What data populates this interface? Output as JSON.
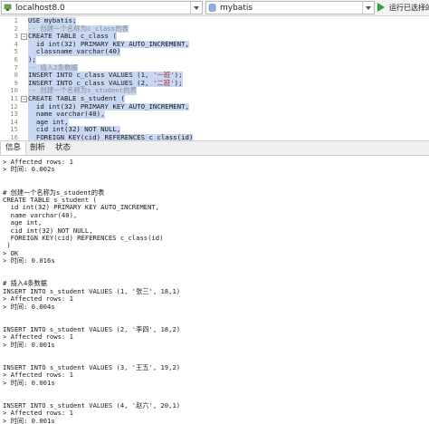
{
  "toolbar": {
    "connection": "localhost8.0",
    "database": "mybatis",
    "run_label": "运行已选择的"
  },
  "editor": {
    "lines": [
      {
        "n": "1",
        "text": "USE mybatis;"
      },
      {
        "n": "2",
        "text": "-- 创建一个名称为c_class的表"
      },
      {
        "n": "3",
        "text": "CREATE TABLE c_class ("
      },
      {
        "n": "4",
        "text": "  id int(32) PRIMARY KEY AUTO_INCREMENT,"
      },
      {
        "n": "5",
        "text": "  classname varchar(40)"
      },
      {
        "n": "6",
        "text": ");"
      },
      {
        "n": "7",
        "text": "-- 插入2条数据"
      },
      {
        "n": "8",
        "text": "INSERT INTO c_class VALUES (1, '一班');"
      },
      {
        "n": "9",
        "text": "INSERT INTO c_class VALUES (2, '二班');"
      },
      {
        "n": "10",
        "text": "-- 创建一个名称为s_student的表"
      },
      {
        "n": "11",
        "text": "CREATE TABLE s_student ("
      },
      {
        "n": "12",
        "text": "  id int(32) PRIMARY KEY AUTO_INCREMENT,"
      },
      {
        "n": "13",
        "text": "  name varchar(40),"
      },
      {
        "n": "14",
        "text": "  age int,"
      },
      {
        "n": "15",
        "text": "  cid int(32) NOT NULL,"
      },
      {
        "n": "16",
        "text": "  FOREIGN KEY(cid) REFERENCES c_class(id)"
      }
    ]
  },
  "tabs": [
    {
      "label": "信息"
    },
    {
      "label": "剖析"
    },
    {
      "label": "状态"
    }
  ],
  "output": {
    "lines": [
      "> Affected rows: 1",
      "> 时间: 0.002s",
      "",
      "",
      "# 创建一个名称为s_student的表",
      "CREATE TABLE s_student (",
      "  id int(32) PRIMARY KEY AUTO_INCREMENT,",
      "  name varchar(40),",
      "  age int,",
      "  cid int(32) NOT NULL,",
      "  FOREIGN KEY(cid) REFERENCES c_class(id)",
      " )",
      "> OK",
      "> 时间: 0.016s",
      "",
      "",
      "# 插入4条数据",
      "INSERT INTO s_student VALUES (1, '张三', 18,1)",
      "> Affected rows: 1",
      "> 时间: 0.004s",
      "",
      "",
      "INSERT INTO s_student VALUES (2, '李四', 18,2)",
      "> Affected rows: 1",
      "> 时间: 0.001s",
      "",
      "",
      "INSERT INTO s_student VALUES (3, '王五', 19,2)",
      "> Affected rows: 1",
      "> 时间: 0.001s",
      "",
      "",
      "INSERT INTO s_student VALUES (4, '赵六', 20,1)",
      "> Affected rows: 1",
      "> 时间: 0.001s"
    ]
  }
}
